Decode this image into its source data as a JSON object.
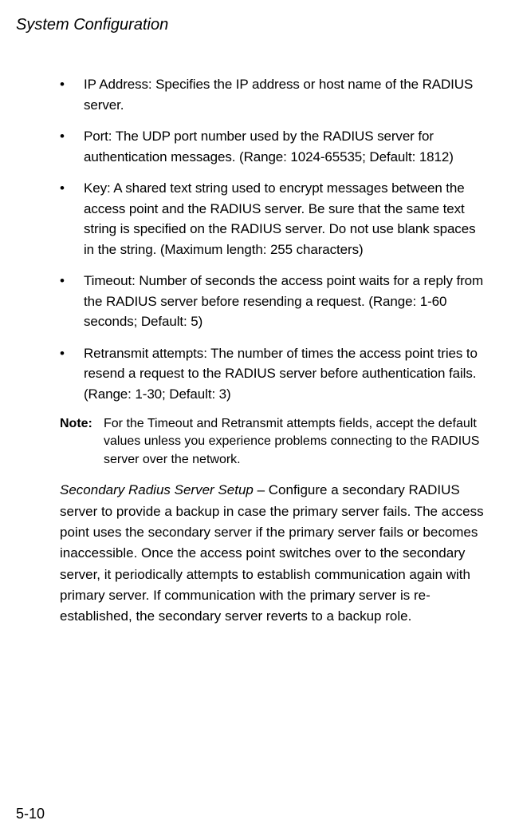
{
  "header": {
    "title": "System Configuration"
  },
  "bullets": {
    "items": [
      "IP Address: Specifies the IP address or host name of the RADIUS server.",
      "Port: The UDP port number used by the RADIUS server for authentication messages. (Range: 1024-65535; Default: 1812)",
      "Key: A shared text string used to encrypt messages between the access point and the RADIUS server. Be sure that the same text string is specified on the RADIUS server. Do not use blank spaces in the string. (Maximum length: 255 characters)",
      "Timeout: Number of seconds the access point waits for a reply from the RADIUS server before resending a request. (Range: 1-60 seconds; Default: 5)",
      "Retransmit attempts: The number of times the access point tries to resend a request to the RADIUS server before authentication fails. (Range: 1-30; Default: 3)"
    ]
  },
  "note": {
    "label": "Note:",
    "text": "For the Timeout and Retransmit attempts fields, accept the default values unless you experience problems connecting to the RADIUS server over the network."
  },
  "secondary": {
    "label": "Secondary Radius Server Setup",
    "text": " – Configure a secondary RADIUS server to provide a backup in case the primary server fails. The access point uses the secondary server if the primary server fails or becomes inaccessible. Once the access point switches over to the secondary server, it periodically attempts to establish communication again with primary server. If communication with the primary server is re-established, the secondary server reverts to a backup role."
  },
  "page_number": "5-10",
  "bullet_char": "•"
}
